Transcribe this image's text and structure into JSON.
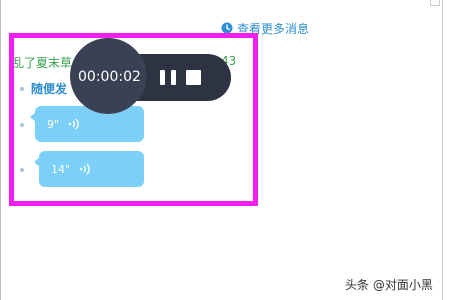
{
  "header": {
    "more_messages_label": "查看更多消息",
    "more_icon": "clock-icon"
  },
  "chat": {
    "group_title_partial": "乱了夏末草",
    "time_partial": "43",
    "sender_partial": "随便发",
    "voice_messages": [
      {
        "duration": "9\"",
        "icon": "sound-wave-icon"
      },
      {
        "duration": "14\"",
        "icon": "sound-wave-icon"
      }
    ]
  },
  "recorder": {
    "elapsed": "00:00:02",
    "pause_icon": "pause-icon",
    "stop_icon": "stop-icon"
  },
  "colors": {
    "highlight": "#f21ff2",
    "bubble": "#7ccff7",
    "recorder_bg": "#2d3343",
    "link": "#2f8fd0",
    "group_title": "#3aa14f"
  },
  "watermark": "头条 @对面小黑"
}
